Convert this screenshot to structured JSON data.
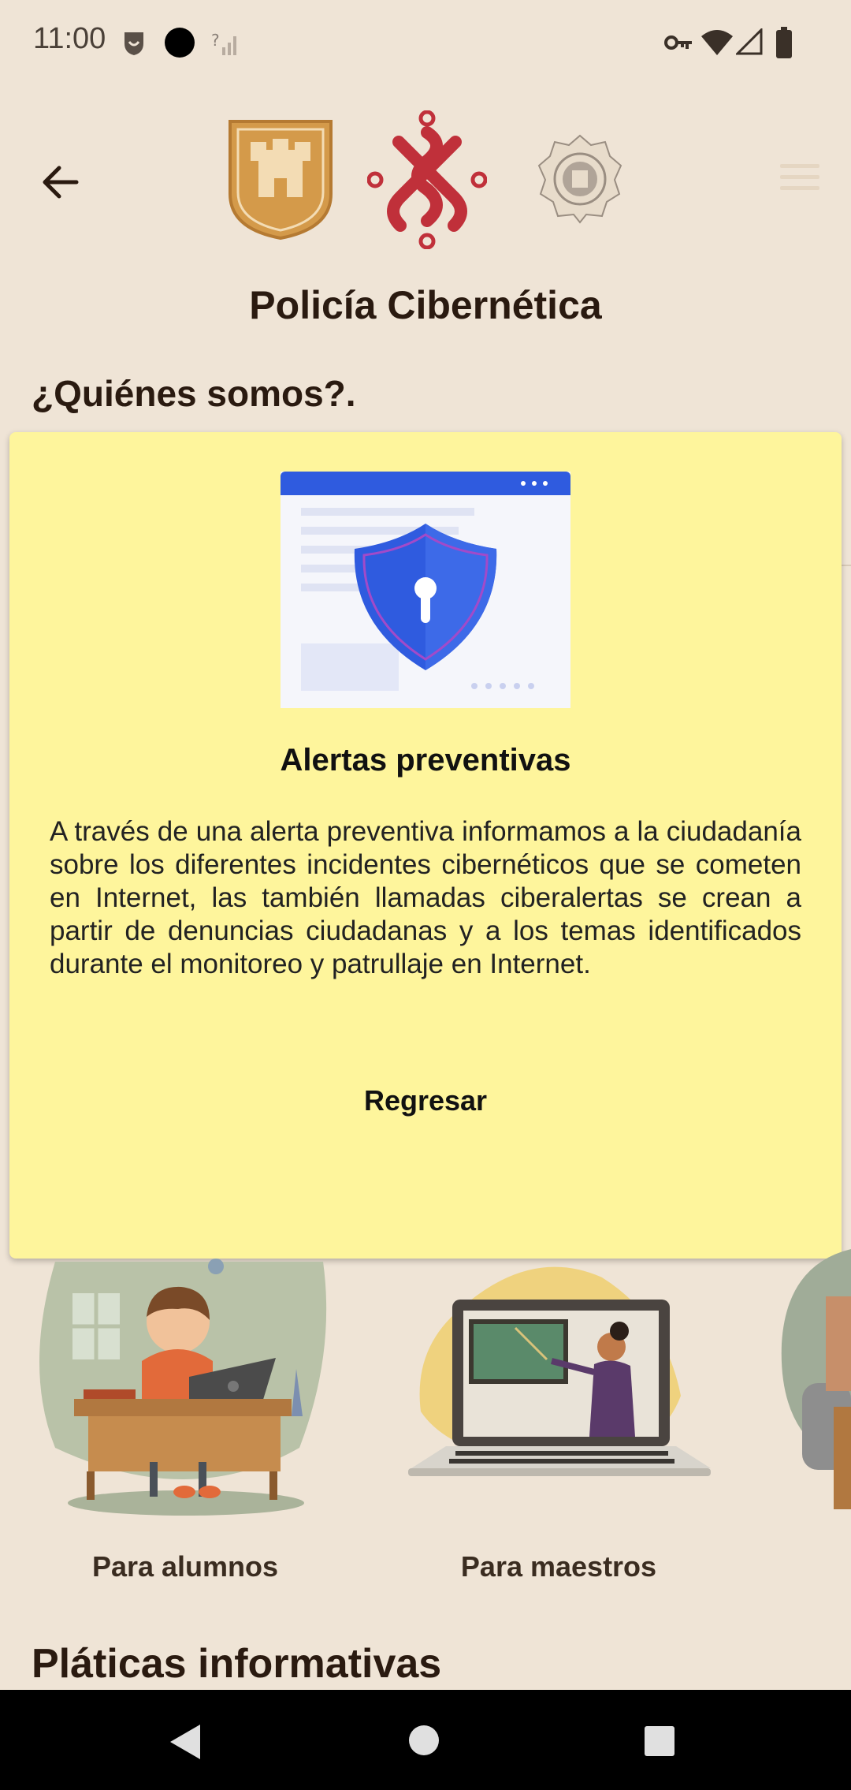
{
  "status_bar": {
    "time": "11:00",
    "icons": [
      "shield-face-icon",
      "camera-dot-icon",
      "no-signal-icon",
      "vpn-key-icon",
      "wifi-icon",
      "cell-signal-icon",
      "battery-icon"
    ]
  },
  "header": {
    "back_icon": "arrow-left-icon",
    "logos": [
      "cdmx-shield-logo",
      "ssc-knot-logo",
      "police-seal-logo"
    ],
    "menu_icon": "hamburger-icon",
    "title": "Policía Cibernética"
  },
  "section": {
    "heading": "¿Quiénes somos?."
  },
  "modal": {
    "illustration": "security-shield-icon",
    "title": "Alertas preventivas",
    "body": "A través de una alerta preventiva informamos a la ciudadanía sobre los diferentes incidentes cibernéticos que se cometen en Internet, las también llamadas ciberalertas se crean a partir de denuncias ciudadanas y a los temas identificados durante el monitoreo y patrullaje en Internet.",
    "back_label": "Regresar"
  },
  "cards": [
    {
      "label": "Para alumnos",
      "illustration": "student-at-desk-illustration"
    },
    {
      "label": "Para maestros",
      "illustration": "teacher-laptop-illustration"
    }
  ],
  "talks": {
    "heading": "Pláticas informativas"
  },
  "nav_bar": {
    "icons": [
      "back-triangle-icon",
      "home-circle-icon",
      "recents-square-icon"
    ]
  },
  "colors": {
    "background": "#efe4d6",
    "modal": "#fef59c",
    "accent_red": "#c0303a",
    "accent_gold": "#d49a4a",
    "shield_blue": "#2f5bdf"
  }
}
